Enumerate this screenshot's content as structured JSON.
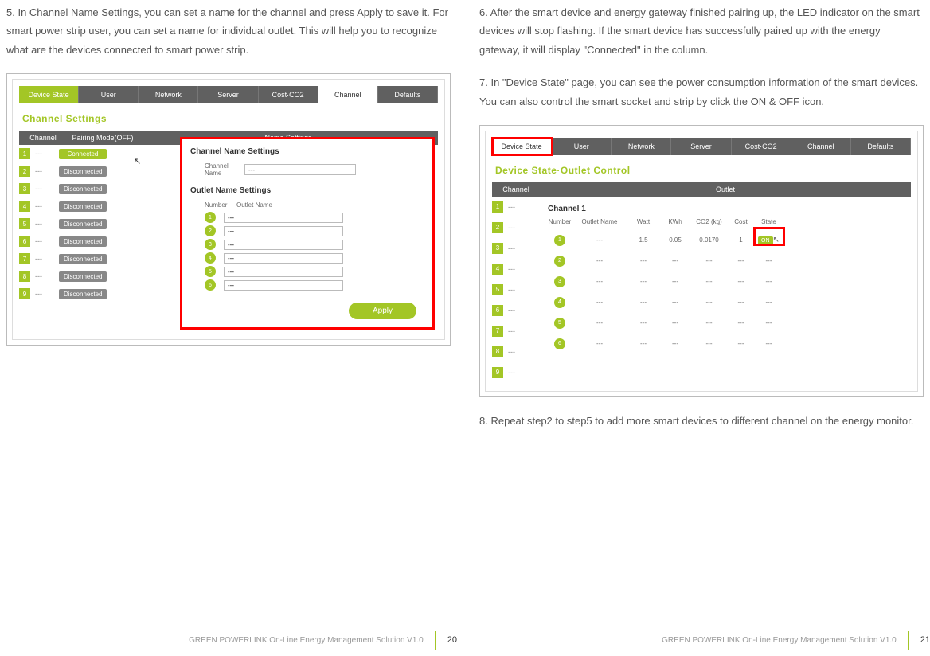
{
  "left": {
    "step5": "5. In Channel Name Settings, you can set a name for the channel and press Apply to save it. For smart power strip user, you can set a name for individual outlet. This will help you to recognize what are the devices connected to smart power strip.",
    "tabs": [
      "Device State",
      "User",
      "Network",
      "Server",
      "Cost·CO2",
      "Channel",
      "Defaults"
    ],
    "section": "Channel Settings",
    "head": {
      "c1": "Channel",
      "c2": "Pairing Mode(OFF)",
      "c3": "Name Settings"
    },
    "rows": [
      {
        "n": "1",
        "dash": "---",
        "status": "Connected",
        "conn": true
      },
      {
        "n": "2",
        "dash": "---",
        "status": "Disconnected",
        "conn": false
      },
      {
        "n": "3",
        "dash": "---",
        "status": "Disconnected",
        "conn": false
      },
      {
        "n": "4",
        "dash": "---",
        "status": "Disconnected",
        "conn": false
      },
      {
        "n": "5",
        "dash": "---",
        "status": "Disconnected",
        "conn": false
      },
      {
        "n": "6",
        "dash": "---",
        "status": "Disconnected",
        "conn": false
      },
      {
        "n": "7",
        "dash": "---",
        "status": "Disconnected",
        "conn": false
      },
      {
        "n": "8",
        "dash": "---",
        "status": "Disconnected",
        "conn": false
      },
      {
        "n": "9",
        "dash": "---",
        "status": "Disconnected",
        "conn": false
      }
    ],
    "modal": {
      "h1": "Channel Name Settings",
      "lbl": "Channel Name",
      "val": "---",
      "h2": "Outlet Name Settings",
      "sub1": "Number",
      "sub2": "Outlet Name",
      "outs": [
        {
          "n": "1",
          "v": "---"
        },
        {
          "n": "2",
          "v": "---"
        },
        {
          "n": "3",
          "v": "---"
        },
        {
          "n": "4",
          "v": "---"
        },
        {
          "n": "5",
          "v": "---"
        },
        {
          "n": "6",
          "v": "---"
        }
      ],
      "apply": "Apply"
    },
    "footer": "GREEN POWERLINK On-Line Energy Management Solution   V1.0",
    "page": "20"
  },
  "right": {
    "step6": "6. After the smart device and energy gateway finished pairing up, the LED indicator on the smart devices will stop flashing. If the smart device has successfully paired up with the energy gateway, it will display \"Connected\" in the column.",
    "step7": "7. In \"Device State\" page, you can see the power consumption information of the smart devices. You can also control the smart socket and strip by click the ON & OFF icon.",
    "tabs": [
      "Device State",
      "User",
      "Network",
      "Server",
      "Cost·CO2",
      "Channel",
      "Defaults"
    ],
    "section": "Device State·Outlet Control",
    "head": {
      "c1": "Channel",
      "c2": "Outlet"
    },
    "chrows": [
      {
        "n": "1",
        "d": "---"
      },
      {
        "n": "2",
        "d": "---"
      },
      {
        "n": "3",
        "d": "---"
      },
      {
        "n": "4",
        "d": "---"
      },
      {
        "n": "5",
        "d": "---"
      },
      {
        "n": "6",
        "d": "---"
      },
      {
        "n": "7",
        "d": "---"
      },
      {
        "n": "8",
        "d": "---"
      },
      {
        "n": "9",
        "d": "---"
      }
    ],
    "ch1": "Channel 1",
    "dhead": {
      "n": "Number",
      "on": "Outlet Name",
      "w": "Watt",
      "k": "KWh",
      "c": "CO2 (kg)",
      "co": "Cost",
      "s": "State"
    },
    "drows": [
      {
        "n": "1",
        "on": "---",
        "w": "1.5",
        "k": "0.05",
        "c": "0.0170",
        "co": "1",
        "s": "ON",
        "active": true
      },
      {
        "n": "2",
        "on": "---",
        "w": "---",
        "k": "---",
        "c": "---",
        "co": "---",
        "s": "---",
        "active": false
      },
      {
        "n": "3",
        "on": "---",
        "w": "---",
        "k": "---",
        "c": "---",
        "co": "---",
        "s": "---",
        "active": false
      },
      {
        "n": "4",
        "on": "---",
        "w": "---",
        "k": "---",
        "c": "---",
        "co": "---",
        "s": "---",
        "active": false
      },
      {
        "n": "5",
        "on": "---",
        "w": "---",
        "k": "---",
        "c": "---",
        "co": "---",
        "s": "---",
        "active": false
      },
      {
        "n": "6",
        "on": "---",
        "w": "---",
        "k": "---",
        "c": "---",
        "co": "---",
        "s": "---",
        "active": false
      }
    ],
    "step8": "8. Repeat step2 to step5 to add more smart devices to different channel on the energy monitor.",
    "footer": "GREEN POWERLINK On-Line Energy Management Solution   V1.0",
    "page": "21"
  }
}
